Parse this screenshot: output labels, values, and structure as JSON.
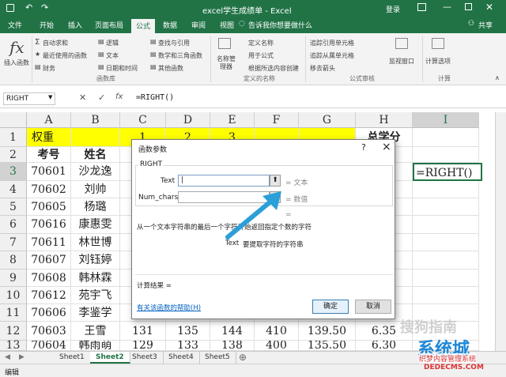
{
  "titlebar": {
    "title": "excel学生成绩单 - Excel",
    "account": "登录"
  },
  "menu_tabs": [
    "文件",
    "开始",
    "插入",
    "页面布局",
    "公式",
    "数据",
    "审阅",
    "视图",
    "告诉我你想要做什么"
  ],
  "share": "共享",
  "ribbon": {
    "insert_function": "插入函数",
    "autosum": "自动求和",
    "recent": "最近使用的函数",
    "financial": "财务",
    "logical": "逻辑",
    "text": "文本",
    "datetime": "日期和时间",
    "lookup": "查找与引用",
    "math": "数学和三角函数",
    "more": "其他函数",
    "name_manager": "名称管理器",
    "define_name": "定义名称",
    "use_in_formula": "用于公式",
    "create_from_selection": "根据所选内容创建",
    "trace_precedents": "追踪引用单元格",
    "trace_dependents": "追踪从属单元格",
    "remove_arrows": "移去箭头",
    "watch_window": "监视窗口",
    "calc_options": "计算选项",
    "group_library": "函数库",
    "group_names": "定义的名称",
    "group_audit": "公式审核",
    "group_calc": "计算"
  },
  "formula_bar": {
    "name_box": "RIGHT",
    "formula": "=RIGHT()",
    "fx": "fx"
  },
  "columns": [
    "A",
    "B",
    "C",
    "D",
    "E",
    "F",
    "G",
    "H",
    "I"
  ],
  "rows": [
    "1",
    "2",
    "3",
    "4",
    "5",
    "6",
    "7",
    "8",
    "9",
    "10",
    "11",
    "12",
    "13"
  ],
  "cells": {
    "r1": [
      "权重",
      "",
      "1",
      "2",
      "3",
      "",
      "",
      "总学分",
      ""
    ],
    "r2": [
      "考号",
      "姓名",
      "",
      "",
      "",
      "",
      "",
      "",
      ""
    ],
    "r3": [
      "70601",
      "沙龙逸",
      "",
      "",
      "",
      "",
      "",
      "",
      "=RIGHT()"
    ],
    "r4": [
      "70602",
      "刘帅",
      "",
      "",
      "",
      "",
      "",
      "",
      ""
    ],
    "r5": [
      "70605",
      "杨璐",
      "",
      "",
      "",
      "",
      "",
      "",
      ""
    ],
    "r6": [
      "70616",
      "康惠雯",
      "",
      "",
      "",
      "",
      "",
      "",
      ""
    ],
    "r7": [
      "70611",
      "林世博",
      "",
      "",
      "",
      "",
      "",
      "",
      ""
    ],
    "r8": [
      "70607",
      "刘钰婷",
      "",
      "",
      "",
      "",
      "",
      "",
      ""
    ],
    "r9": [
      "70608",
      "韩林霖",
      "",
      "",
      "",
      "",
      "",
      "",
      ""
    ],
    "r10": [
      "70612",
      "苑宇飞",
      "",
      "",
      "",
      "",
      "",
      "",
      ""
    ],
    "r11": [
      "70606",
      "李鉴学",
      "",
      "",
      "",
      "",
      "",
      "",
      ""
    ],
    "r12": [
      "70603",
      "王雪",
      "131",
      "135",
      "144",
      "410",
      "139.50",
      "6.35",
      ""
    ],
    "r13": [
      "70604",
      "韩雨萌",
      "129",
      "133",
      "138",
      "400",
      "135.50",
      "6.30",
      ""
    ]
  },
  "dialog": {
    "title": "函数参数",
    "help_q": "?",
    "close": "×",
    "func_name": "RIGHT",
    "arg1_label": "Text",
    "arg1_value": "|",
    "arg1_hint": "= 文本",
    "arg2_label": "Num_chars",
    "arg2_hint": "= 数值",
    "eq": "=",
    "description": "从一个文本字符串的最后一个字符开始返回指定个数的字符",
    "arg_desc_name": "Text",
    "arg_desc": "要提取字符的字符串",
    "result_label": "计算结果 =",
    "help_link": "有关该函数的帮助(H)",
    "ok": "确定",
    "cancel": "取消"
  },
  "sheets": [
    "Sheet1",
    "Sheet2",
    "Sheet3",
    "Sheet4",
    "Sheet5"
  ],
  "active_sheet": "Sheet2",
  "status": "编辑",
  "watermarks": {
    "w1": "搜狗指南",
    "w2": "系统城",
    "w3": "织梦内容管理系统",
    "w4": "DEDECMS.COM"
  },
  "colors": {
    "excel_green": "#217346",
    "yellow": "#ffff00",
    "arrow": "#2a9fd8"
  }
}
